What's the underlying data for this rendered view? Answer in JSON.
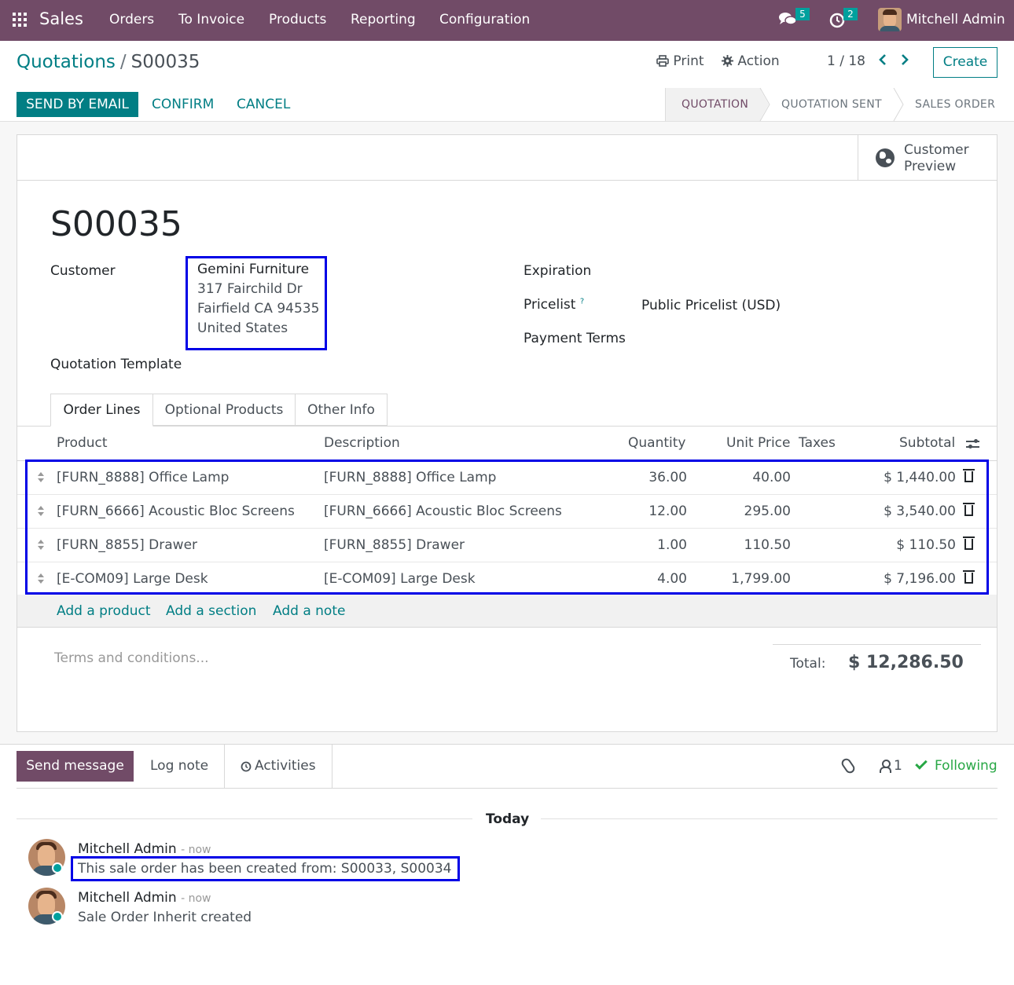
{
  "nav": {
    "brand": "Sales",
    "menu": [
      "Orders",
      "To Invoice",
      "Products",
      "Reporting",
      "Configuration"
    ],
    "messages_badge": "5",
    "activities_badge": "2",
    "user": "Mitchell Admin"
  },
  "control_panel": {
    "breadcrumb_parent": "Quotations",
    "breadcrumb_sep": "/",
    "breadcrumb_current": "S00035",
    "print_label": "Print",
    "action_label": "Action",
    "pager": "1 / 18",
    "create_label": "Create"
  },
  "actions": {
    "send_by_email": "SEND BY EMAIL",
    "confirm": "CONFIRM",
    "cancel": "CANCEL"
  },
  "statusbar": [
    "QUOTATION",
    "QUOTATION SENT",
    "SALES ORDER"
  ],
  "button_box": {
    "customer_preview_line1": "Customer",
    "customer_preview_line2": "Preview"
  },
  "form": {
    "name": "S00035",
    "customer_label": "Customer",
    "customer_name": "Gemini Furniture",
    "address_line1": "317 Fairchild Dr",
    "address_line2": "Fairfield CA 94535",
    "address_line3": "United States",
    "template_label": "Quotation Template",
    "expiration_label": "Expiration",
    "pricelist_label": "Pricelist",
    "pricelist_help": "?",
    "pricelist_value": "Public Pricelist (USD)",
    "payment_terms_label": "Payment Terms"
  },
  "tabs": [
    "Order Lines",
    "Optional Products",
    "Other Info"
  ],
  "table": {
    "headers": {
      "product": "Product",
      "description": "Description",
      "quantity": "Quantity",
      "unit_price": "Unit Price",
      "taxes": "Taxes",
      "subtotal": "Subtotal"
    },
    "rows": [
      {
        "product": "[FURN_8888] Office Lamp",
        "description": "[FURN_8888] Office Lamp",
        "quantity": "36.00",
        "unit_price": "40.00",
        "taxes": "",
        "subtotal": "$ 1,440.00"
      },
      {
        "product": "[FURN_6666] Acoustic Bloc Screens",
        "description": "[FURN_6666] Acoustic Bloc Screens",
        "quantity": "12.00",
        "unit_price": "295.00",
        "taxes": "",
        "subtotal": "$ 3,540.00"
      },
      {
        "product": "[FURN_8855] Drawer",
        "description": "[FURN_8855] Drawer",
        "quantity": "1.00",
        "unit_price": "110.50",
        "taxes": "",
        "subtotal": "$ 110.50"
      },
      {
        "product": "[E-COM09] Large Desk",
        "description": "[E-COM09] Large Desk",
        "quantity": "4.00",
        "unit_price": "1,799.00",
        "taxes": "",
        "subtotal": "$ 7,196.00"
      }
    ],
    "add_product": "Add a product",
    "add_section": "Add a section",
    "add_note": "Add a note"
  },
  "footer": {
    "terms_placeholder": "Terms and conditions...",
    "total_label": "Total:",
    "total_value": "$ 12,286.50"
  },
  "chatter": {
    "send_message": "Send message",
    "log_note": "Log note",
    "activities": "Activities",
    "followers_count": "1",
    "following": "Following",
    "date_separator": "Today",
    "messages": [
      {
        "author": "Mitchell Admin",
        "time": "- now",
        "body": "This sale order has been created from: S00033, S00034"
      },
      {
        "author": "Mitchell Admin",
        "time": "- now",
        "body": "Sale Order Inherit created"
      }
    ]
  }
}
